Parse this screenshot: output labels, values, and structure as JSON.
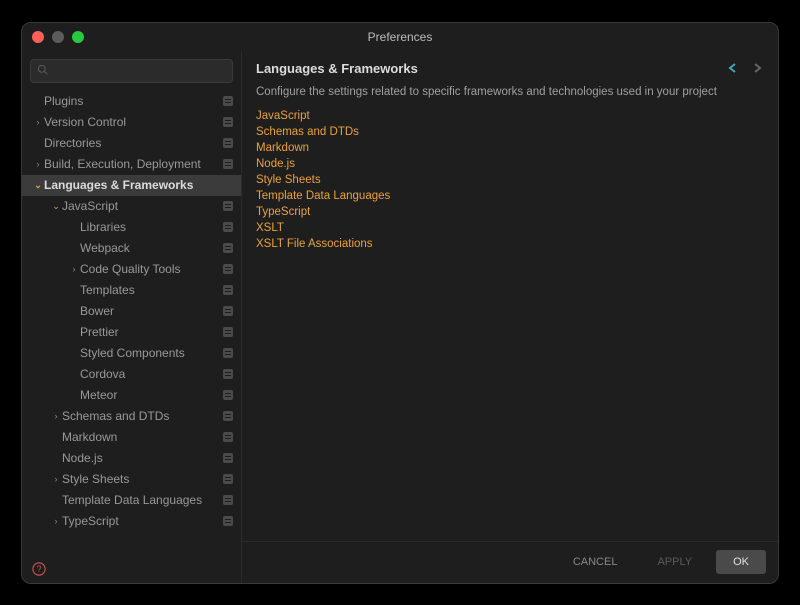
{
  "window": {
    "title": "Preferences"
  },
  "search": {
    "placeholder": ""
  },
  "sidebar": {
    "items": [
      {
        "label": "Plugins",
        "indent": 0,
        "chevron": "",
        "badge": true
      },
      {
        "label": "Version Control",
        "indent": 0,
        "chevron": "right",
        "badge": true
      },
      {
        "label": "Directories",
        "indent": 0,
        "chevron": "",
        "badge": true
      },
      {
        "label": "Build, Execution, Deployment",
        "indent": 0,
        "chevron": "right",
        "badge": true
      },
      {
        "label": "Languages & Frameworks",
        "indent": 0,
        "chevron": "down",
        "badge": false,
        "selected": true
      },
      {
        "label": "JavaScript",
        "indent": 1,
        "chevron": "down",
        "badge": true
      },
      {
        "label": "Libraries",
        "indent": 2,
        "chevron": "",
        "badge": true
      },
      {
        "label": "Webpack",
        "indent": 2,
        "chevron": "",
        "badge": true
      },
      {
        "label": "Code Quality Tools",
        "indent": 2,
        "chevron": "right",
        "badge": true
      },
      {
        "label": "Templates",
        "indent": 2,
        "chevron": "",
        "badge": true
      },
      {
        "label": "Bower",
        "indent": 2,
        "chevron": "",
        "badge": true
      },
      {
        "label": "Prettier",
        "indent": 2,
        "chevron": "",
        "badge": true
      },
      {
        "label": "Styled Components",
        "indent": 2,
        "chevron": "",
        "badge": true
      },
      {
        "label": "Cordova",
        "indent": 2,
        "chevron": "",
        "badge": true
      },
      {
        "label": "Meteor",
        "indent": 2,
        "chevron": "",
        "badge": true
      },
      {
        "label": "Schemas and DTDs",
        "indent": 1,
        "chevron": "right",
        "badge": true
      },
      {
        "label": "Markdown",
        "indent": 1,
        "chevron": "",
        "badge": true
      },
      {
        "label": "Node.js",
        "indent": 1,
        "chevron": "",
        "badge": true
      },
      {
        "label": "Style Sheets",
        "indent": 1,
        "chevron": "right",
        "badge": true
      },
      {
        "label": "Template Data Languages",
        "indent": 1,
        "chevron": "",
        "badge": true
      },
      {
        "label": "TypeScript",
        "indent": 1,
        "chevron": "right",
        "badge": true
      }
    ]
  },
  "main": {
    "title": "Languages & Frameworks",
    "description": "Configure the settings related to specific frameworks and technologies used in your project",
    "links": [
      "JavaScript",
      "Schemas and DTDs",
      "Markdown",
      "Node.js",
      "Style Sheets",
      "Template Data Languages",
      "TypeScript",
      "XSLT",
      "XSLT File Associations"
    ]
  },
  "footer": {
    "cancel": "CANCEL",
    "apply": "APPLY",
    "ok": "OK"
  }
}
